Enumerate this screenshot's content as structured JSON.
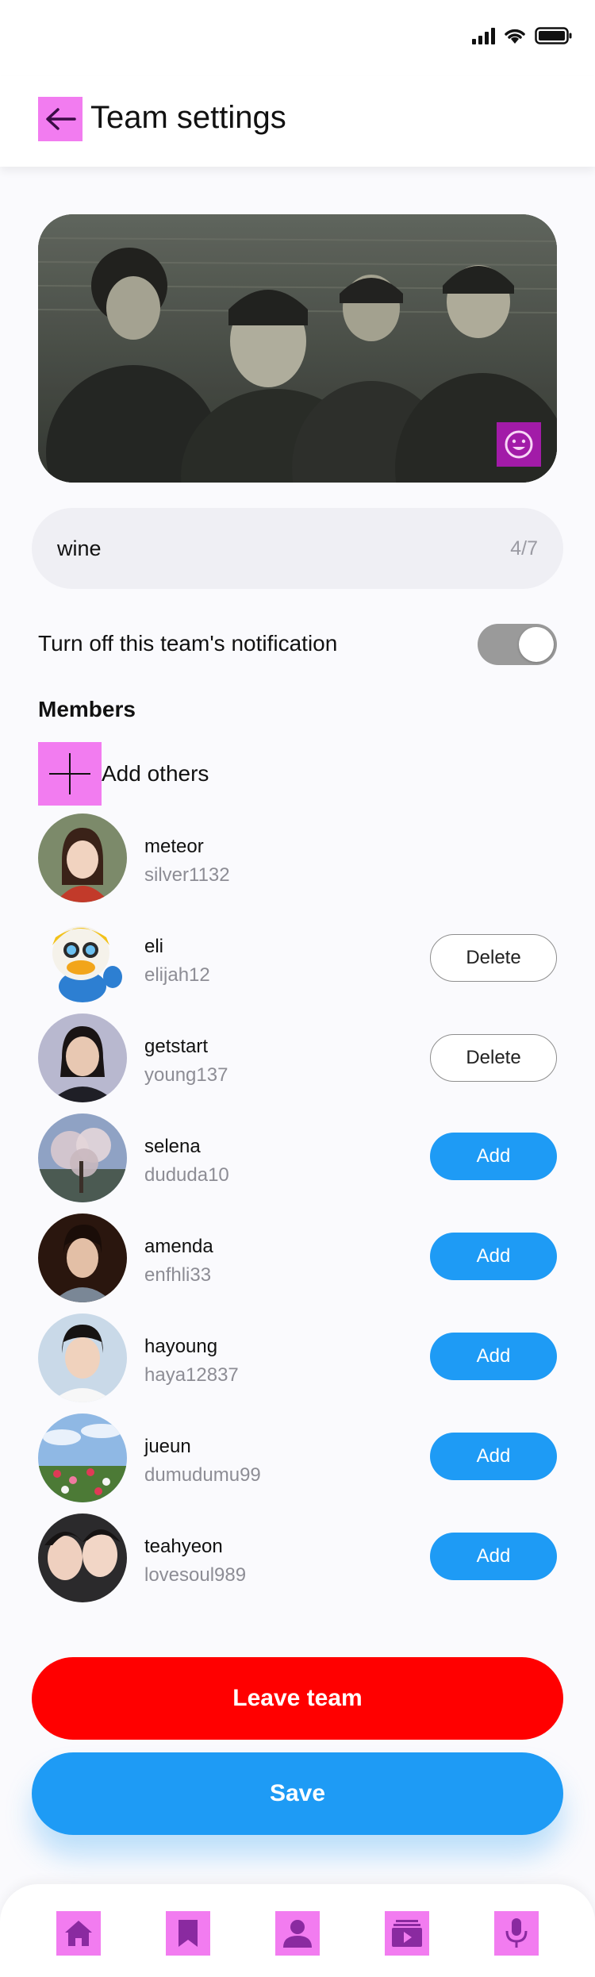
{
  "header": {
    "title": "Team settings"
  },
  "team": {
    "name": "wine",
    "name_counter": "4/7"
  },
  "notification": {
    "label": "Turn off this team's notification",
    "enabled": true
  },
  "members_section": {
    "title": "Members",
    "add_label": "Add others"
  },
  "members": [
    {
      "name": "meteor",
      "id": "silver1132",
      "action": ""
    },
    {
      "name": "eli",
      "id": "elijah12",
      "action": "Delete"
    },
    {
      "name": "getstart",
      "id": "young137",
      "action": "Delete"
    },
    {
      "name": "selena",
      "id": "dududa10",
      "action": "Add"
    },
    {
      "name": "amenda",
      "id": "enfhli33",
      "action": "Add"
    },
    {
      "name": "hayoung",
      "id": "haya12837",
      "action": "Add"
    },
    {
      "name": "jueun",
      "id": "dumudumu99",
      "action": "Add"
    },
    {
      "name": "teahyeon",
      "id": "lovesoul989",
      "action": "Add"
    }
  ],
  "actions": {
    "leave_label": "Leave team",
    "save_label": "Save"
  },
  "nav": [
    "home-icon",
    "bookmark-icon",
    "profile-icon",
    "video-library-icon",
    "microphone-icon"
  ],
  "colors": {
    "primary": "#1e9bf5",
    "danger": "#ff0000",
    "icon_placeholder": "#f27cf0",
    "toggle_off": "#9a9a9a"
  }
}
